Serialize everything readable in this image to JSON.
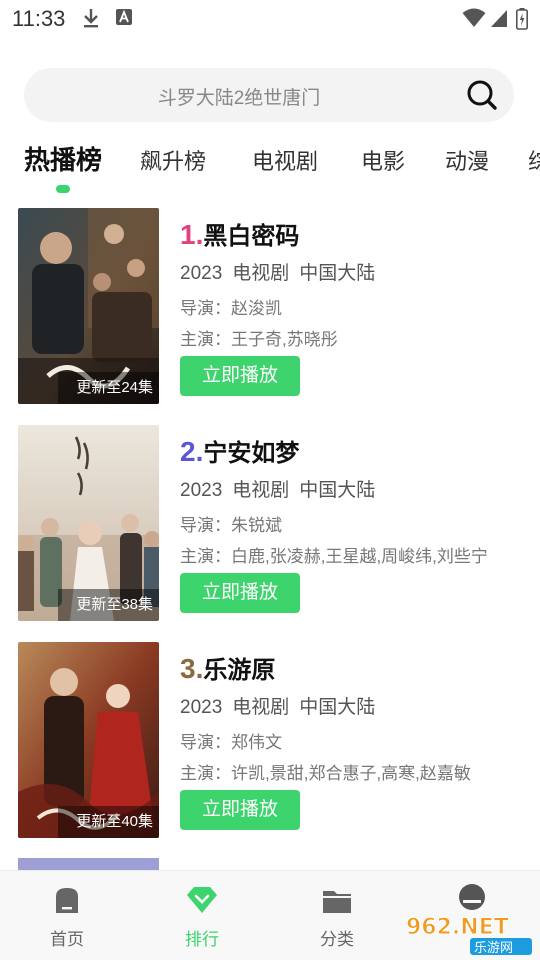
{
  "status_bar": {
    "time": "11:33",
    "icons": [
      "download-icon",
      "a-badge-icon",
      "wifi-icon",
      "signal-icon",
      "battery-icon"
    ]
  },
  "search": {
    "placeholder": "斗罗大陆2绝世唐门",
    "icon": "search-icon"
  },
  "tabs": [
    {
      "label": "热播榜",
      "active": true
    },
    {
      "label": "飙升榜",
      "active": false
    },
    {
      "label": "电视剧",
      "active": false
    },
    {
      "label": "电影",
      "active": false
    },
    {
      "label": "动漫",
      "active": false
    },
    {
      "label": "综",
      "active": false
    }
  ],
  "list": [
    {
      "rank": "1.",
      "rank_color": "#e2417f",
      "title": "黑白密码",
      "year": "2023",
      "category": "电视剧",
      "region": "中国大陆",
      "director": "导演：赵浚凯",
      "cast": "主演：王子奇,苏晓彤",
      "badge": "更新至24集",
      "play_label": "立即播放",
      "poster_title": "黑白密码"
    },
    {
      "rank": "2.",
      "rank_color": "#5a57d6",
      "title": "宁安如梦",
      "year": "2023",
      "category": "电视剧",
      "region": "中国大陆",
      "director": "导演：朱锐斌",
      "cast": "主演：白鹿,张凌赫,王星越,周峻纬,刘些宁",
      "badge": "更新至38集",
      "play_label": "立即播放",
      "poster_title": "宁安如梦"
    },
    {
      "rank": "3.",
      "rank_color": "#8a6a3f",
      "title": "乐游原",
      "year": "2023",
      "category": "电视剧",
      "region": "中国大陆",
      "director": "导演：郑伟文",
      "cast": "主演：许凯,景甜,郑合惠子,高寒,赵嘉敏",
      "badge": "更新至40集",
      "play_label": "立即播放",
      "poster_title": "乐游原"
    }
  ],
  "bottom_nav": [
    {
      "label": "首页",
      "icon": "home-icon",
      "active": false
    },
    {
      "label": "排行",
      "icon": "ranking-icon",
      "active": true
    },
    {
      "label": "分类",
      "icon": "folder-icon",
      "active": false
    },
    {
      "label": "",
      "icon": "profile-icon",
      "active": false
    }
  ],
  "watermark": {
    "main": "962.NET",
    "sub": "乐游网"
  },
  "colors": {
    "accent": "#3dd36d"
  }
}
